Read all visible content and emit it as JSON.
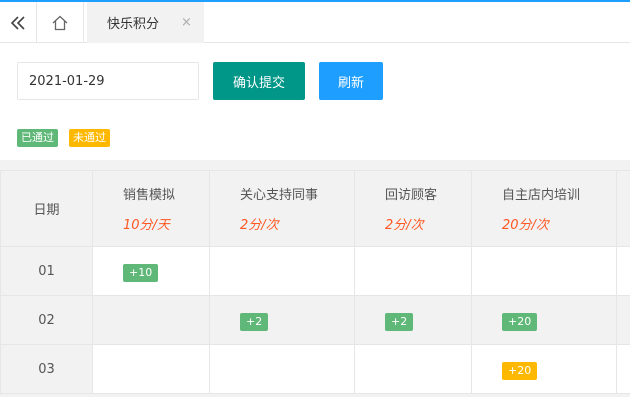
{
  "topbar": {
    "back_icon": "double-chevron-left-icon",
    "home_icon": "home-icon",
    "tab": {
      "label": "快乐积分",
      "close_icon": "close-icon"
    }
  },
  "form": {
    "date_value": "2021-01-29",
    "submit_label": "确认提交",
    "refresh_label": "刷新"
  },
  "legend": {
    "passed": "已通过",
    "failed": "未通过"
  },
  "colors": {
    "primary": "#009688",
    "blue": "#1e9fff",
    "passed": "#5fb878",
    "pending": "#ffb800",
    "score": "#ff5722"
  },
  "table": {
    "date_header": "日期",
    "columns": [
      {
        "name": "销售模拟",
        "score": "10分/天"
      },
      {
        "name": "关心支持同事",
        "score": "2分/次"
      },
      {
        "name": "回访顾客",
        "score": "2分/次"
      },
      {
        "name": "自主店内培训",
        "score": "20分/次"
      }
    ],
    "rows": [
      {
        "date": "01",
        "cells": [
          {
            "value": "+10",
            "status": "passed"
          },
          null,
          null,
          null
        ]
      },
      {
        "date": "02",
        "cells": [
          null,
          {
            "value": "+2",
            "status": "passed"
          },
          {
            "value": "+2",
            "status": "passed"
          },
          {
            "value": "+20",
            "status": "passed"
          }
        ]
      },
      {
        "date": "03",
        "cells": [
          null,
          null,
          null,
          {
            "value": "+20",
            "status": "pending"
          }
        ]
      }
    ]
  }
}
